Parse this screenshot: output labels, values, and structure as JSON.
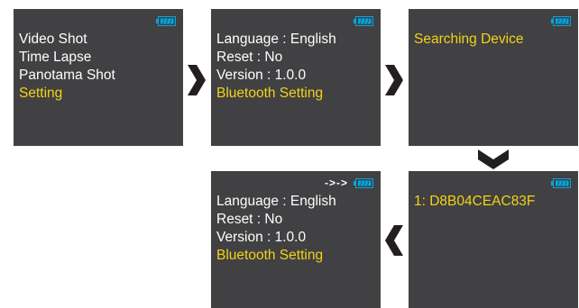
{
  "colors": {
    "screen": "#414042",
    "text": "#ffffff",
    "highlight": "#f2d318",
    "battery": "#00a7e1",
    "arrow": "#231f20"
  },
  "screen_main_menu": {
    "items": [
      "Video Shot",
      "Time Lapse",
      "Panotama Shot",
      "Setting"
    ],
    "selected_index": 3
  },
  "screen_setting_1": {
    "items": [
      "Language : English",
      "Reset : No",
      "Version : 1.0.0",
      "Bluetooth Setting"
    ],
    "selected_index": 3
  },
  "screen_searching": {
    "items": [
      "Searching Device"
    ],
    "selected_index": 0
  },
  "screen_device_found": {
    "items": [
      "1: D8B04CEAC83F"
    ],
    "selected_index": 0
  },
  "screen_setting_2": {
    "status": "->->",
    "items": [
      "Language : English",
      "Reset : No",
      "Version : 1.0.0",
      "Bluetooth Setting"
    ],
    "selected_index": 3
  }
}
